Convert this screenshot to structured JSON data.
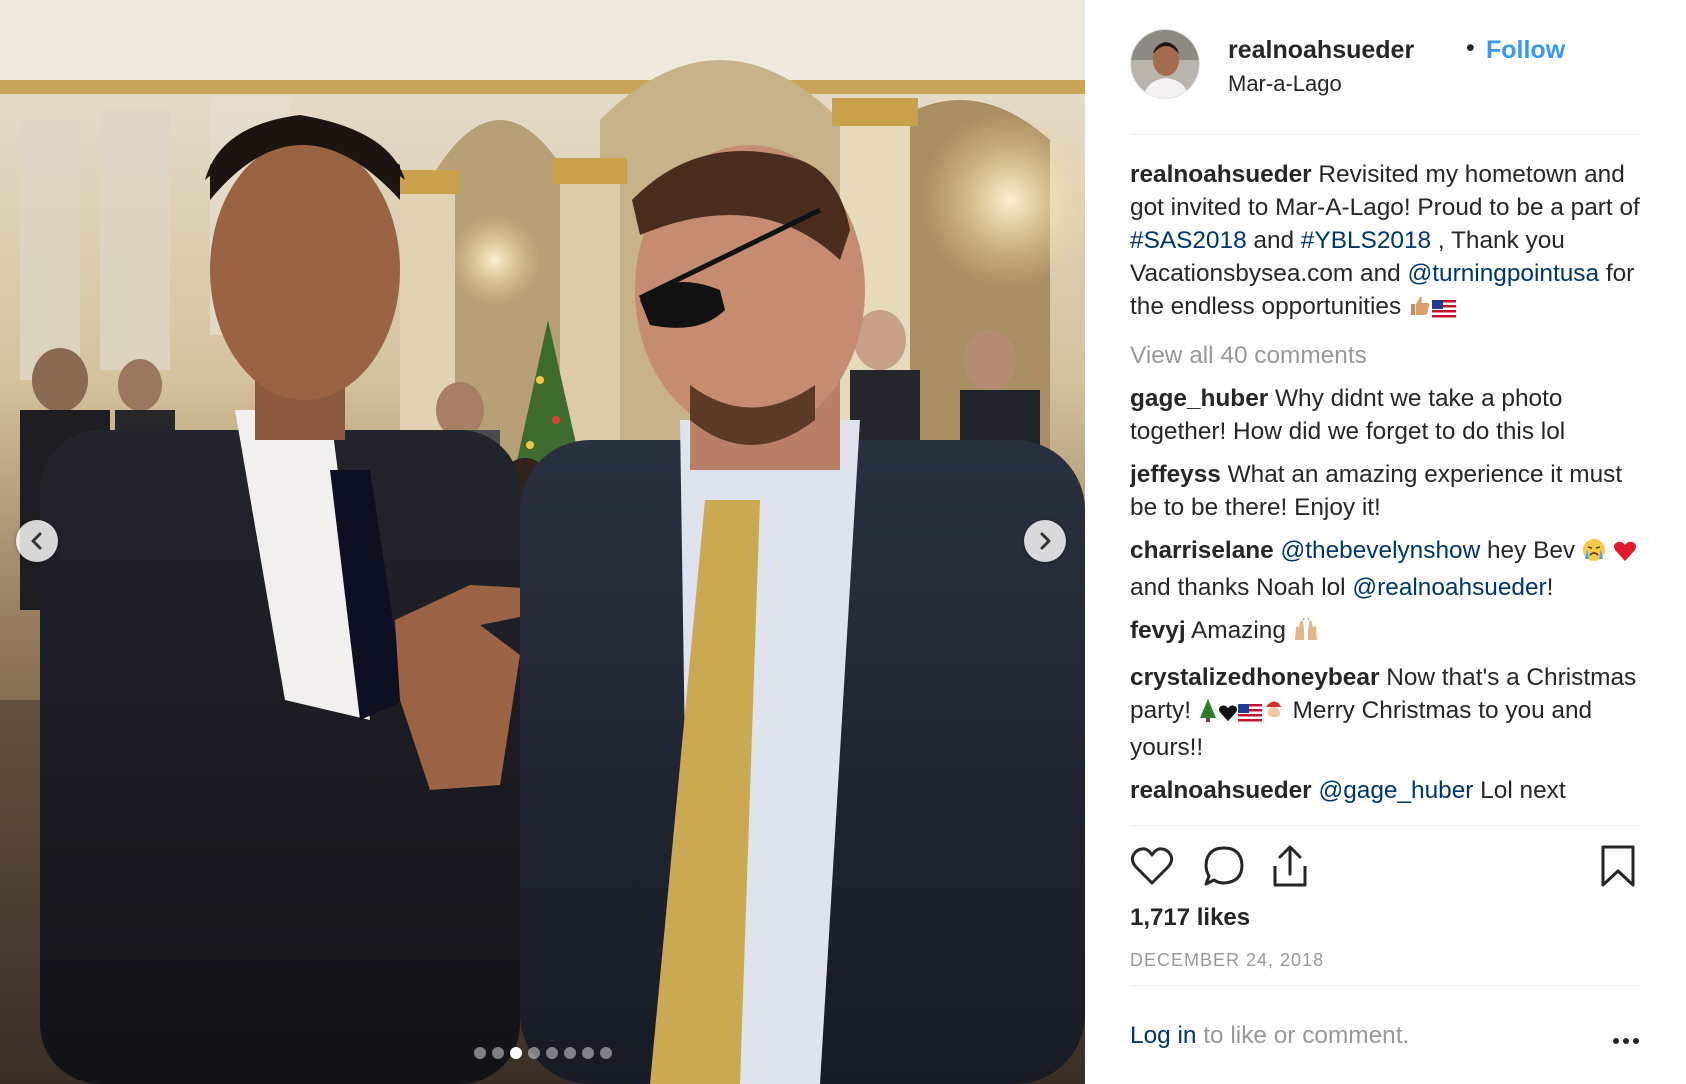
{
  "post": {
    "username": "realnoahsueder",
    "separator": "•",
    "follow_label": "Follow",
    "location": "Mar-a-Lago",
    "caption": {
      "user": "realnoahsueder",
      "text_1": " Revisited my hometown and got invited to Mar-A-Lago! Proud to be a part of ",
      "tag_1": "#SAS2018",
      "text_2": " and ",
      "tag_2": "#YBLS2018",
      "text_3": " , Thank you Vacationsbysea.com and ",
      "mention": "@turningpointusa",
      "text_4": " for the endless opportunities "
    },
    "view_all_comments": "View all 40 comments",
    "comments": [
      {
        "user": "gage_huber",
        "text": " Why didnt we take a photo together! How did we forget to do this lol"
      },
      {
        "user": "jeffeyss",
        "text": " What an amazing experience it must be to be there! Enjoy it!"
      },
      {
        "user": "charriselane",
        "mention_1": "@thebevelynshow",
        "text_1": " hey Bev ",
        "text_2": " and thanks Noah lol ",
        "mention_2": "@realnoahsueder",
        "text_3": "!"
      },
      {
        "user": "fevyj",
        "text": " Amazing "
      },
      {
        "user": "crystalizedhoneybear",
        "text_1": " Now that's a Christmas party! ",
        "text_2": " Merry Christmas to you and yours!!"
      },
      {
        "user": "realnoahsueder",
        "mention": "@gage_huber",
        "text": " Lol next"
      }
    ],
    "likes": "1,717 likes",
    "date": "DECEMBER 24, 2018",
    "footer": {
      "login": "Log in",
      "rest": " to like or comment."
    }
  },
  "carousel": {
    "total": 8,
    "active_index": 2
  },
  "icons": {
    "prev": "chevron-left-icon",
    "next": "chevron-right-icon",
    "like": "heart-icon",
    "comment": "comment-bubble-icon",
    "share": "share-upload-icon",
    "save": "bookmark-icon",
    "more": "ellipsis-icon"
  },
  "colors": {
    "accent": "#3897f0",
    "link": "#003569",
    "muted": "#999999",
    "text": "#262626"
  }
}
